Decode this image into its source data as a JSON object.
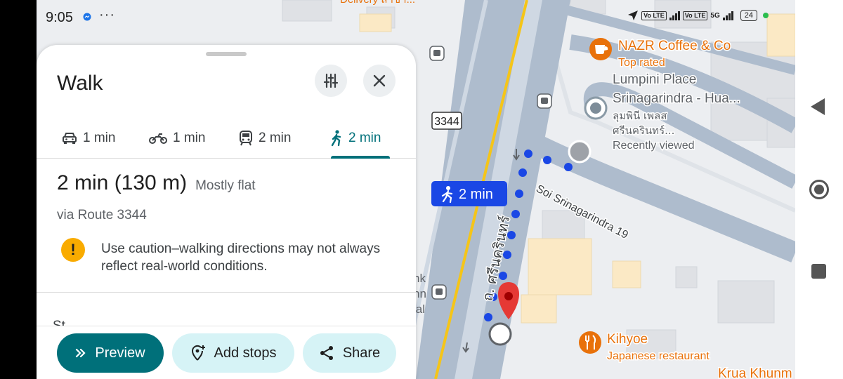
{
  "status_bar": {
    "time": "9:05",
    "more": "···",
    "badge1": "Vo LTE",
    "badge2": "Vo LTE",
    "network": "5G",
    "battery": "24"
  },
  "sheet": {
    "title": "Walk",
    "tabs": [
      {
        "mode": "car-icon",
        "label": "1 min"
      },
      {
        "mode": "motorcycle-icon",
        "label": "1 min"
      },
      {
        "mode": "transit-icon",
        "label": "2 min"
      },
      {
        "mode": "walk-icon",
        "label": "2 min",
        "active": true
      }
    ],
    "summary": {
      "duration": "2 min (130 m)",
      "terrain": "Mostly flat"
    },
    "via": "via Route 3344",
    "warning": "Use caution–walking directions may not always reflect real-world conditions.",
    "stops_peek": "St",
    "buttons": {
      "preview": "Preview",
      "add_stops": "Add stops",
      "share": "Share"
    }
  },
  "map": {
    "route_badge": "2 min",
    "route_label": "3344",
    "street_soi": "Soi Srinagarindra 19",
    "street_thai": "ถ. ศรีนครินทร์",
    "top_cut_label": "Delivery สาขา...",
    "poi_coffee": {
      "name": "NAZR Coffee & Co",
      "sub": "Top rated"
    },
    "poi_lumpini": {
      "line1": "Lumpini Place",
      "line2": "Srinagarindra -  Hua...",
      "line3": "ลุมพินี เพลส",
      "line4": "ศรีนครินทร์...",
      "sub": "Recently viewed"
    },
    "poi_kihyoe": {
      "name": "Kihyoe",
      "sub": "Japanese restaurant"
    },
    "poi_krua": "Krua Khunm",
    "left_cut_labels": [
      "nk",
      "hn",
      "ial"
    ],
    "colors": {
      "route_dots": "#1a47e5",
      "road": "#aebccd",
      "highway_line": "#f5c518",
      "pin": "#e53935",
      "poi_orange": "#e8710a",
      "teal": "#00707a"
    }
  }
}
